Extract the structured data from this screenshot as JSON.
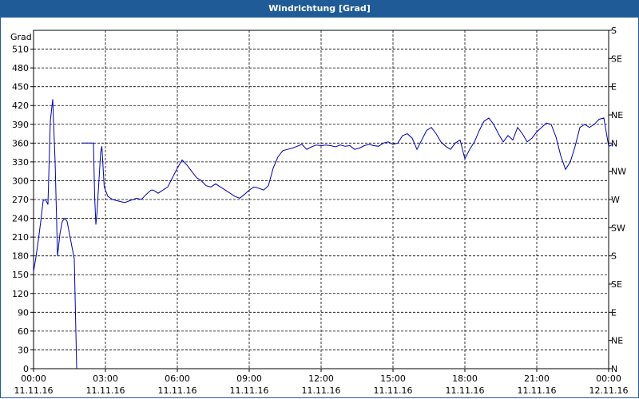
{
  "window": {
    "title": "Windrichtung [Grad]"
  },
  "chart_data": {
    "type": "line",
    "title": "Windrichtung [Grad]",
    "ylabel": "Grad",
    "ylim": [
      0,
      540
    ],
    "y_ticks": [
      0,
      30,
      60,
      90,
      120,
      150,
      180,
      210,
      240,
      270,
      300,
      330,
      360,
      390,
      420,
      450,
      480,
      510
    ],
    "y2_ticks": [
      {
        "v": 0,
        "label": "N"
      },
      {
        "v": 45,
        "label": "NE"
      },
      {
        "v": 90,
        "label": "E"
      },
      {
        "v": 135,
        "label": "SE"
      },
      {
        "v": 180,
        "label": "S"
      },
      {
        "v": 225,
        "label": "SW"
      },
      {
        "v": 270,
        "label": "W"
      },
      {
        "v": 315,
        "label": "NW"
      },
      {
        "v": 360,
        "label": "N"
      },
      {
        "v": 405,
        "label": "NE"
      },
      {
        "v": 450,
        "label": "E"
      },
      {
        "v": 495,
        "label": "SE"
      },
      {
        "v": 540,
        "label": "S"
      }
    ],
    "xlim": [
      0,
      24
    ],
    "x_ticks": [
      {
        "h": 0,
        "time": "00:00",
        "date": "11.11.16"
      },
      {
        "h": 3,
        "time": "03:00",
        "date": "11.11.16"
      },
      {
        "h": 6,
        "time": "06:00",
        "date": "11.11.16"
      },
      {
        "h": 9,
        "time": "09:00",
        "date": "11.11.16"
      },
      {
        "h": 12,
        "time": "12:00",
        "date": "11.11.16"
      },
      {
        "h": 15,
        "time": "15:00",
        "date": "11.11.16"
      },
      {
        "h": 18,
        "time": "18:00",
        "date": "11.11.16"
      },
      {
        "h": 21,
        "time": "21:00",
        "date": "11.11.16"
      },
      {
        "h": 24,
        "time": "00:00",
        "date": "12.11.16"
      }
    ],
    "grid": true,
    "series": [
      {
        "color": "#0000b0",
        "segments": [
          [
            [
              0.0,
              155
            ],
            [
              0.1,
              178
            ],
            [
              0.2,
              205
            ],
            [
              0.3,
              235
            ],
            [
              0.4,
              268
            ],
            [
              0.5,
              270
            ],
            [
              0.6,
              262
            ],
            [
              0.7,
              395
            ],
            [
              0.8,
              430
            ],
            [
              0.9,
              330
            ],
            [
              1.0,
              180
            ],
            [
              1.1,
              215
            ],
            [
              1.2,
              235
            ],
            [
              1.3,
              240
            ],
            [
              1.4,
              235
            ],
            [
              1.5,
              215
            ],
            [
              1.6,
              195
            ],
            [
              1.7,
              175
            ],
            [
              1.8,
              0
            ]
          ],
          [
            [
              2.0,
              360
            ],
            [
              2.3,
              360
            ],
            [
              2.5,
              360
            ],
            [
              2.55,
              275
            ],
            [
              2.6,
              230
            ],
            [
              2.65,
              250
            ],
            [
              2.8,
              345
            ],
            [
              2.85,
              355
            ],
            [
              2.95,
              290
            ],
            [
              3.1,
              275
            ],
            [
              3.3,
              270
            ],
            [
              3.5,
              268
            ],
            [
              3.8,
              265
            ],
            [
              4.0,
              268
            ],
            [
              4.3,
              272
            ],
            [
              4.5,
              270
            ],
            [
              4.7,
              278
            ],
            [
              4.9,
              285
            ],
            [
              5.0,
              285
            ],
            [
              5.2,
              280
            ],
            [
              5.4,
              285
            ],
            [
              5.6,
              290
            ],
            [
              5.8,
              305
            ],
            [
              6.0,
              320
            ],
            [
              6.2,
              333
            ],
            [
              6.4,
              325
            ],
            [
              6.6,
              315
            ],
            [
              6.8,
              305
            ],
            [
              7.0,
              300
            ],
            [
              7.2,
              292
            ],
            [
              7.4,
              290
            ],
            [
              7.6,
              295
            ],
            [
              7.8,
              290
            ],
            [
              8.0,
              285
            ],
            [
              8.2,
              280
            ],
            [
              8.4,
              275
            ],
            [
              8.6,
              272
            ],
            [
              8.8,
              278
            ],
            [
              9.0,
              285
            ],
            [
              9.2,
              290
            ],
            [
              9.4,
              288
            ],
            [
              9.6,
              285
            ],
            [
              9.8,
              292
            ],
            [
              10.0,
              320
            ],
            [
              10.2,
              338
            ],
            [
              10.4,
              348
            ],
            [
              10.6,
              350
            ],
            [
              10.8,
              352
            ],
            [
              11.0,
              355
            ],
            [
              11.2,
              358
            ],
            [
              11.4,
              350
            ],
            [
              11.6,
              354
            ],
            [
              11.8,
              357
            ],
            [
              12.0,
              356
            ],
            [
              12.2,
              357
            ],
            [
              12.4,
              356
            ],
            [
              12.6,
              354
            ],
            [
              12.8,
              357
            ],
            [
              13.0,
              355
            ],
            [
              13.2,
              356
            ],
            [
              13.4,
              350
            ],
            [
              13.6,
              352
            ],
            [
              13.8,
              356
            ],
            [
              14.0,
              358
            ],
            [
              14.2,
              356
            ],
            [
              14.4,
              355
            ],
            [
              14.6,
              360
            ],
            [
              14.8,
              362
            ],
            [
              15.0,
              358
            ],
            [
              15.2,
              360
            ],
            [
              15.4,
              372
            ],
            [
              15.6,
              375
            ],
            [
              15.8,
              368
            ],
            [
              16.0,
              350
            ],
            [
              16.2,
              365
            ],
            [
              16.4,
              380
            ],
            [
              16.6,
              385
            ],
            [
              16.8,
              375
            ],
            [
              17.0,
              362
            ],
            [
              17.2,
              355
            ],
            [
              17.4,
              350
            ],
            [
              17.6,
              360
            ],
            [
              17.8,
              365
            ],
            [
              18.0,
              335
            ],
            [
              18.2,
              350
            ],
            [
              18.4,
              362
            ],
            [
              18.6,
              380
            ],
            [
              18.8,
              395
            ],
            [
              19.0,
              400
            ],
            [
              19.2,
              390
            ],
            [
              19.4,
              375
            ],
            [
              19.6,
              362
            ],
            [
              19.8,
              372
            ],
            [
              20.0,
              365
            ],
            [
              20.2,
              385
            ],
            [
              20.4,
              375
            ],
            [
              20.6,
              362
            ],
            [
              20.8,
              368
            ],
            [
              21.0,
              378
            ],
            [
              21.2,
              385
            ],
            [
              21.4,
              392
            ],
            [
              21.6,
              390
            ],
            [
              21.8,
              370
            ],
            [
              22.0,
              340
            ],
            [
              22.2,
              318
            ],
            [
              22.4,
              330
            ],
            [
              22.6,
              355
            ],
            [
              22.8,
              385
            ],
            [
              23.0,
              390
            ],
            [
              23.2,
              385
            ],
            [
              23.4,
              390
            ],
            [
              23.6,
              398
            ],
            [
              23.8,
              400
            ],
            [
              24.0,
              355
            ],
            [
              24.2,
              358
            ]
          ]
        ]
      }
    ]
  }
}
